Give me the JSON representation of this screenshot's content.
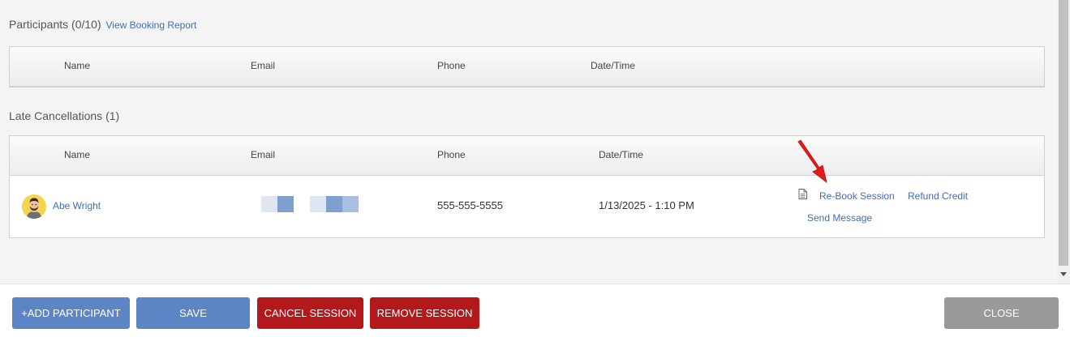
{
  "participants": {
    "title": "Participants (0/10)",
    "report_link": "View Booking Report",
    "columns": [
      "Name",
      "Email",
      "Phone",
      "Date/Time"
    ]
  },
  "late_cancellations": {
    "title": "Late Cancellations (1)",
    "columns": [
      "Name",
      "Email",
      "Phone",
      "Date/Time"
    ],
    "rows": [
      {
        "name": "Abe Wright",
        "phone": "555-555-5555",
        "datetime": "1/13/2025 - 1:10 PM",
        "actions": {
          "rebook": "Re-Book Session",
          "refund": "Refund Credit",
          "message": "Send Message"
        }
      }
    ]
  },
  "footer": {
    "add_participant": "+ADD PARTICIPANT",
    "save": "SAVE",
    "cancel_session": "CANCEL SESSION",
    "remove_session": "REMOVE SESSION",
    "close": "CLOSE"
  },
  "colors": {
    "link": "#3d6fb3",
    "button_blue": "#5b85c4",
    "button_red": "#b3191b",
    "button_gray": "#999999",
    "annotation_arrow": "#e8191b"
  },
  "icons": {
    "document": "document-icon",
    "avatar": "user-avatar",
    "annotation": "red-arrow-icon"
  }
}
